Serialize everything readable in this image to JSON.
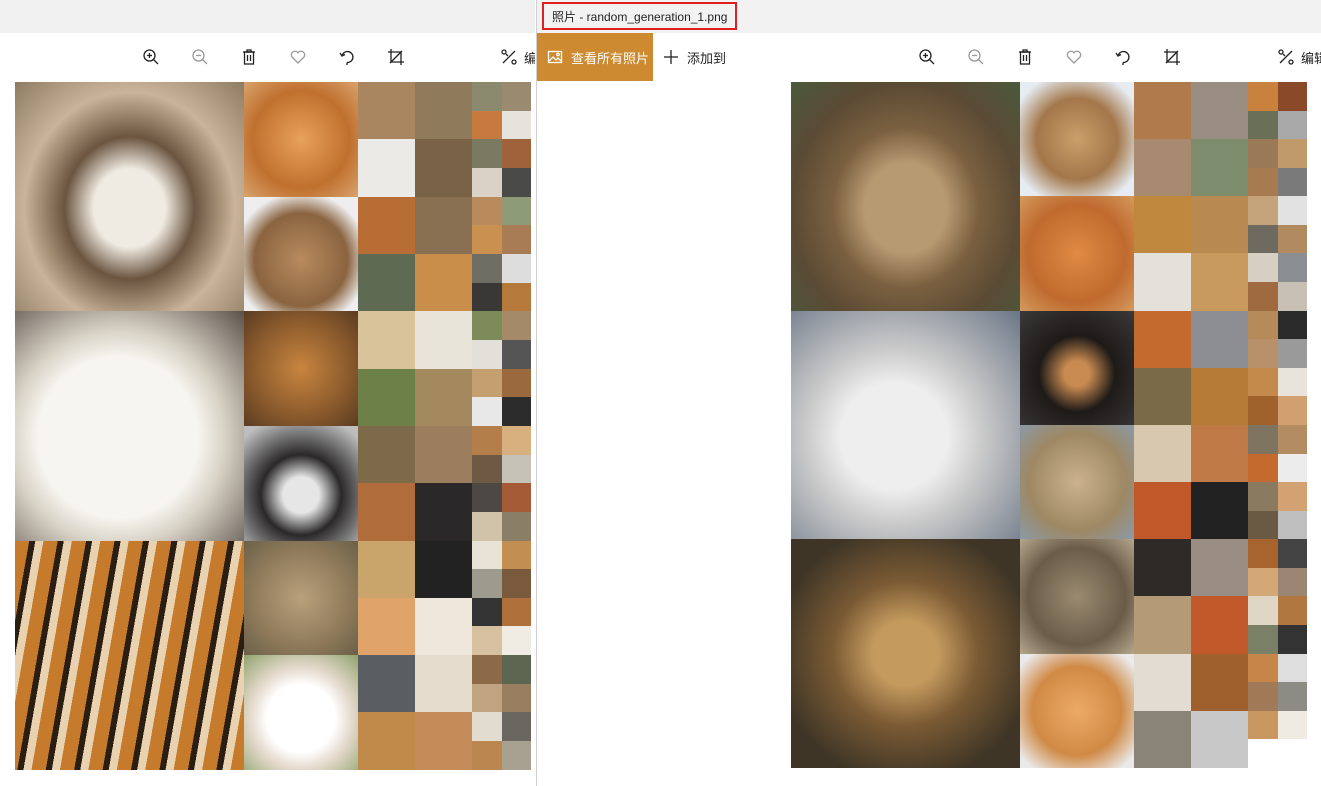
{
  "left_window": {
    "toolbar": {
      "zoom_in": "zoom-in-icon",
      "zoom_out": "zoom-out-icon",
      "delete": "trash-icon",
      "favorite": "heart-icon",
      "rotate": "rotate-icon",
      "crop": "crop-icon",
      "edit_label": "编"
    },
    "image_alt": "Grid of generated animal faces"
  },
  "right_window": {
    "title": "照片 - random_generation_1.png",
    "view_all_label": "查看所有照片",
    "add_to_label": "添加到",
    "toolbar": {
      "zoom_in": "zoom-in-icon",
      "zoom_out": "zoom-out-icon",
      "delete": "trash-icon",
      "favorite": "heart-icon",
      "rotate": "rotate-icon",
      "crop": "crop-icon",
      "edit_label": "编辑"
    }
  },
  "colors": {
    "accent": "#cd8a31",
    "title_highlight": "#e02020"
  }
}
